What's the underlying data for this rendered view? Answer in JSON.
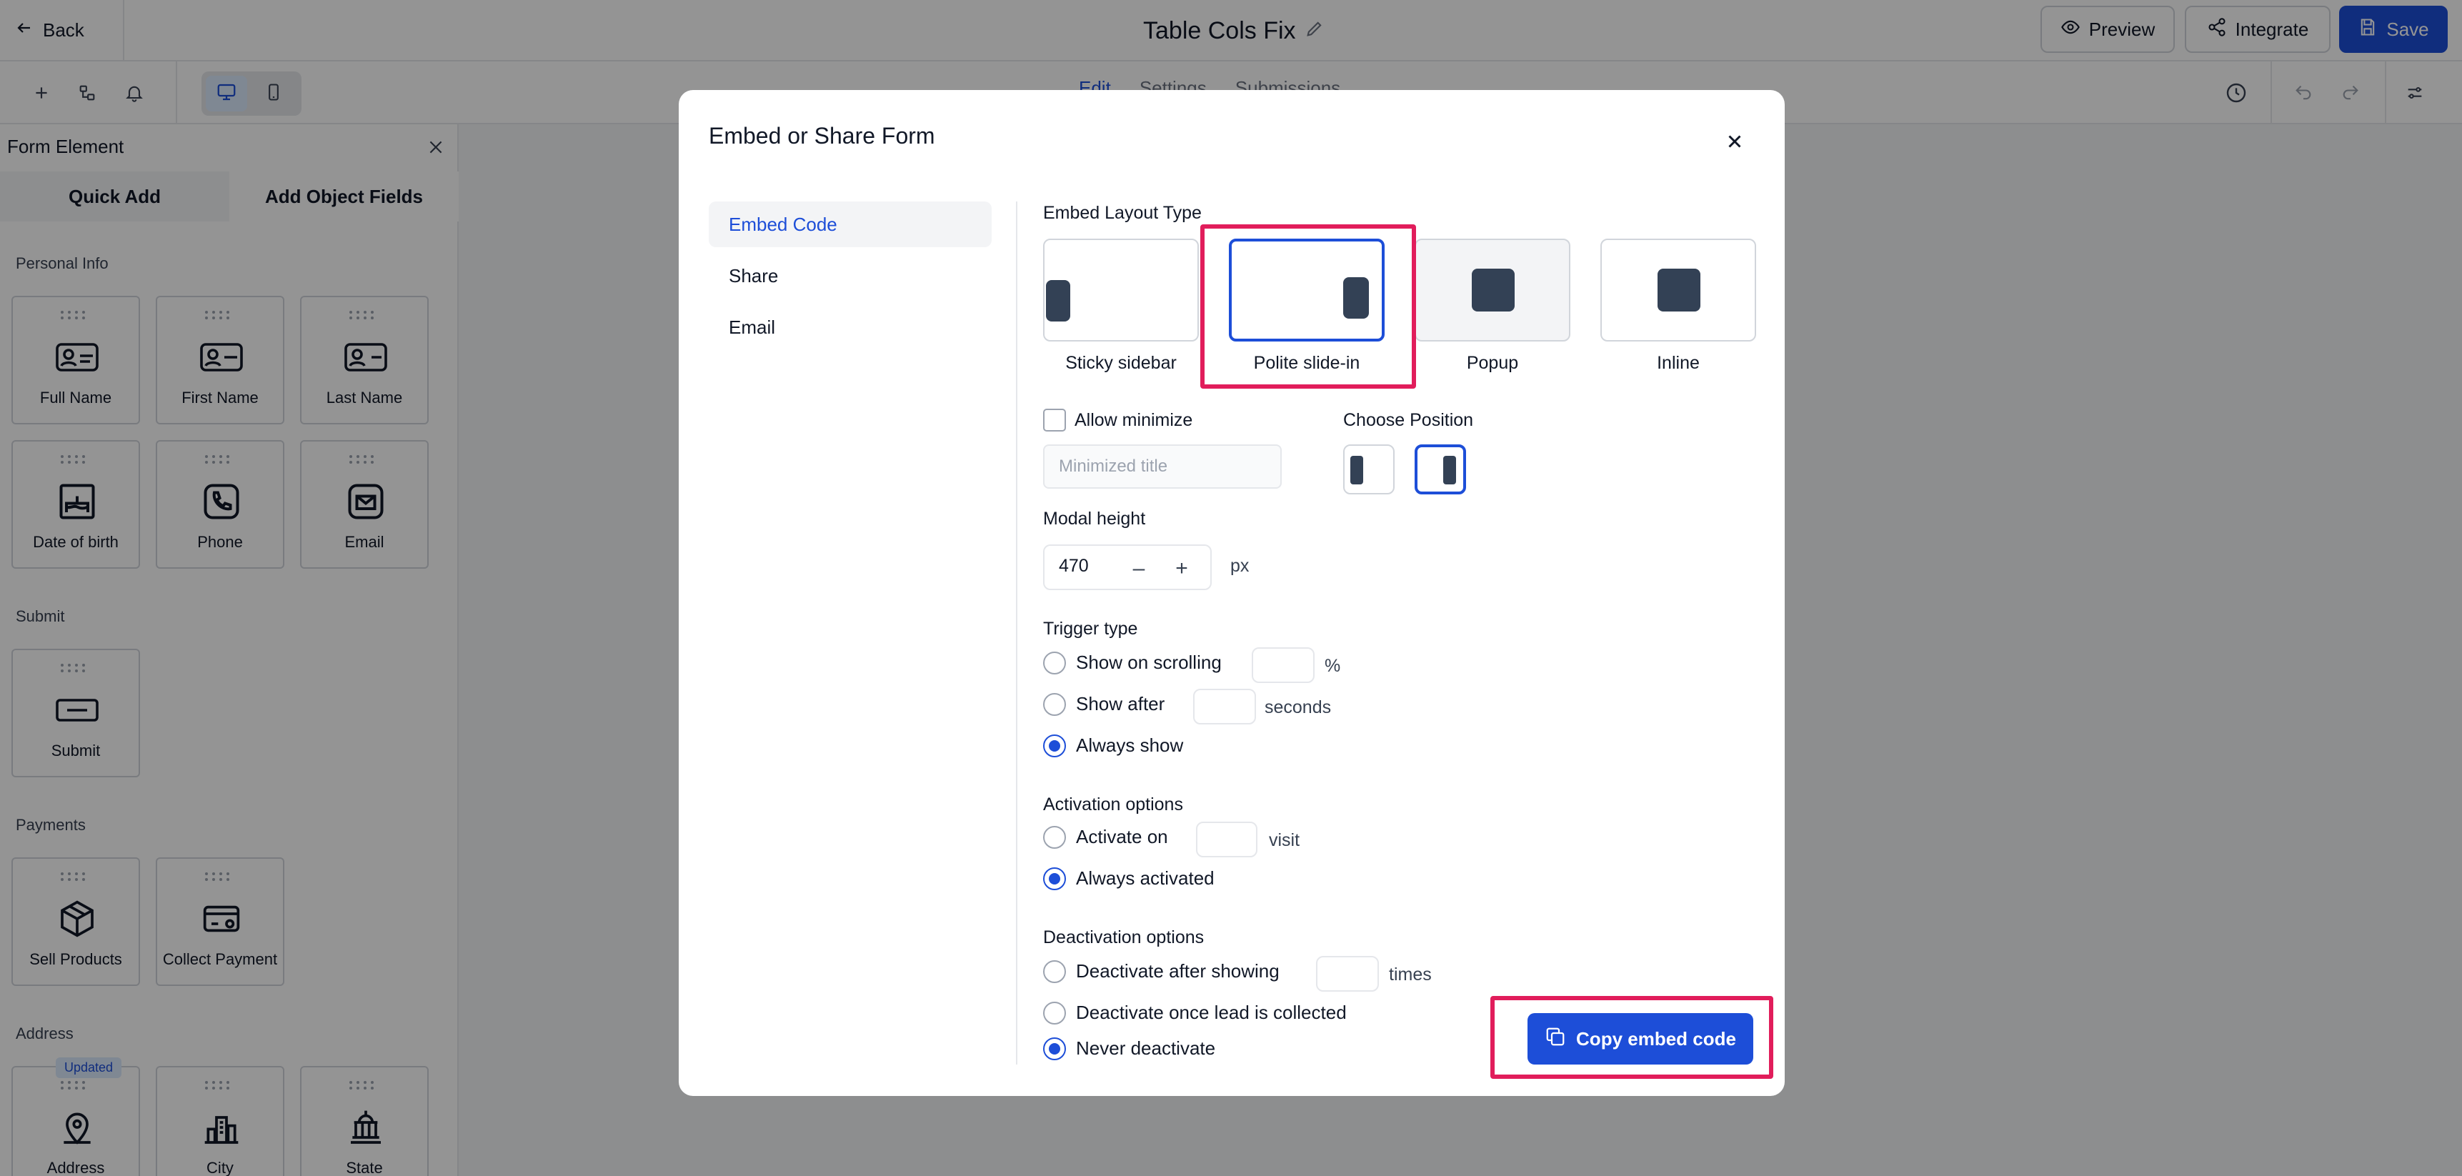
{
  "topbar": {
    "back_label": "Back",
    "form_title": "Table Cols Fix",
    "preview_label": "Preview",
    "integrate_label": "Integrate",
    "save_label": "Save"
  },
  "toolbar": {
    "tabs": [
      "Edit",
      "Settings",
      "Submissions"
    ]
  },
  "left_panel": {
    "title": "Form Element",
    "tabs": [
      "Quick Add",
      "Add Object Fields"
    ],
    "sections": {
      "personal_info": "Personal Info",
      "submit": "Submit",
      "payments": "Payments",
      "address": "Address"
    },
    "fields": {
      "full_name": "Full Name",
      "first_name": "First Name",
      "last_name": "Last Name",
      "date_of_birth": "Date of birth",
      "phone": "Phone",
      "email": "Email",
      "submit": "Submit",
      "sell_products": "Sell Products",
      "collect_payment": "Collect Payment",
      "address": "Address",
      "city": "City",
      "state": "State"
    },
    "updated_badge": "Updated"
  },
  "modal": {
    "title": "Embed or Share Form",
    "nav": [
      "Embed Code",
      "Share",
      "Email"
    ],
    "embed_layout_type_label": "Embed Layout Type",
    "layouts": [
      "Sticky sidebar",
      "Polite slide-in",
      "Popup",
      "Inline"
    ],
    "selected_layout": "Polite slide-in",
    "allow_minimize_label": "Allow minimize",
    "minimized_title_placeholder": "Minimized title",
    "choose_position_label": "Choose Position",
    "modal_height_label": "Modal height",
    "modal_height_value": "470",
    "modal_height_unit": "px",
    "trigger_type_label": "Trigger type",
    "trigger": {
      "show_on_scrolling": "Show on scrolling",
      "scroll_unit": "%",
      "show_after": "Show after",
      "seconds_unit": "seconds",
      "always_show": "Always show"
    },
    "activation_label": "Activation options",
    "activation": {
      "activate_on": "Activate on",
      "visit_unit": "visit",
      "always_activated": "Always activated"
    },
    "deactivation_label": "Deactivation options",
    "deactivation": {
      "deactivate_after_showing": "Deactivate after showing",
      "times_unit": "times",
      "deactivate_once_lead": "Deactivate once lead is collected",
      "never_deactivate": "Never deactivate"
    },
    "copy_button": "Copy embed code"
  },
  "colors": {
    "accent": "#1d4ed8",
    "highlight": "#e11d5b",
    "preview_block": "#334155"
  }
}
